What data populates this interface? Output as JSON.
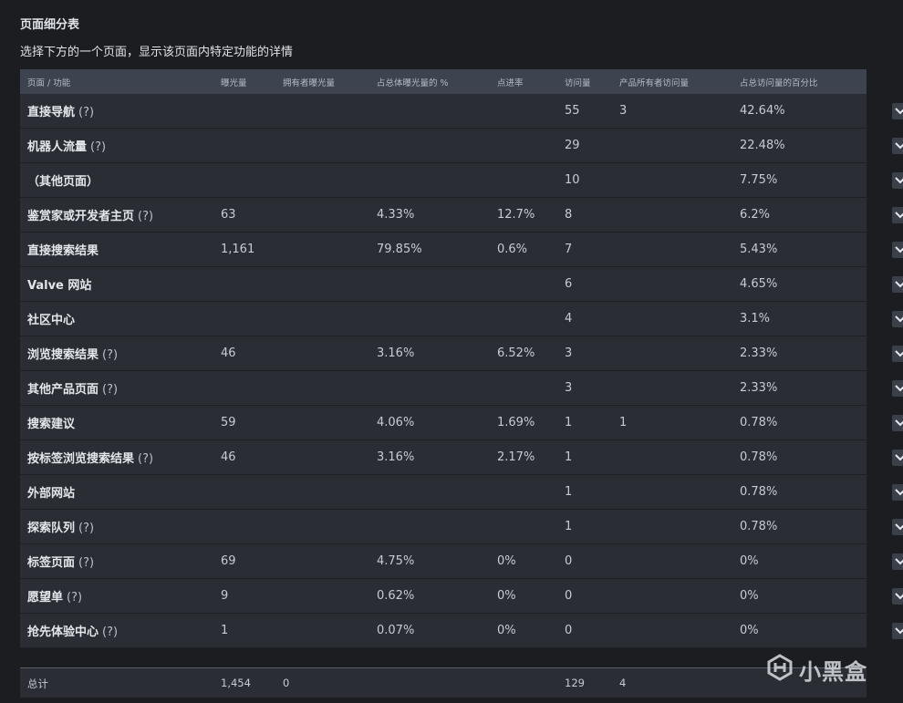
{
  "page": {
    "title": "页面细分表",
    "subtitle": "选择下方的一个页面，显示该页面内特定功能的详情"
  },
  "table": {
    "headers": [
      "页面 / 功能",
      "曝光量",
      "拥有者曝光量",
      "占总体曝光量的 %",
      "点进率",
      "访问量",
      "产品所有者访问量",
      "占总访问量的百分比"
    ],
    "rows": [
      {
        "name": "直接导航",
        "hint": "(?)",
        "impressions": "",
        "owner_impressions": "",
        "impression_pct": "",
        "ctr": "",
        "visits": "55",
        "owner_visits": "3",
        "visit_pct": "42.64%"
      },
      {
        "name": "机器人流量",
        "hint": "(?)",
        "impressions": "",
        "owner_impressions": "",
        "impression_pct": "",
        "ctr": "",
        "visits": "29",
        "owner_visits": "",
        "visit_pct": "22.48%"
      },
      {
        "name": "（其他页面）",
        "hint": "",
        "impressions": "",
        "owner_impressions": "",
        "impression_pct": "",
        "ctr": "",
        "visits": "10",
        "owner_visits": "",
        "visit_pct": "7.75%"
      },
      {
        "name": "鉴赏家或开发者主页",
        "hint": "(?)",
        "impressions": "63",
        "owner_impressions": "",
        "impression_pct": "4.33%",
        "ctr": "12.7%",
        "visits": "8",
        "owner_visits": "",
        "visit_pct": "6.2%"
      },
      {
        "name": "直接搜索结果",
        "hint": "",
        "impressions": "1,161",
        "owner_impressions": "",
        "impression_pct": "79.85%",
        "ctr": "0.6%",
        "visits": "7",
        "owner_visits": "",
        "visit_pct": "5.43%"
      },
      {
        "name": "Valve 网站",
        "hint": "",
        "impressions": "",
        "owner_impressions": "",
        "impression_pct": "",
        "ctr": "",
        "visits": "6",
        "owner_visits": "",
        "visit_pct": "4.65%"
      },
      {
        "name": "社区中心",
        "hint": "",
        "impressions": "",
        "owner_impressions": "",
        "impression_pct": "",
        "ctr": "",
        "visits": "4",
        "owner_visits": "",
        "visit_pct": "3.1%"
      },
      {
        "name": "浏览搜索结果",
        "hint": "(?)",
        "impressions": "46",
        "owner_impressions": "",
        "impression_pct": "3.16%",
        "ctr": "6.52%",
        "visits": "3",
        "owner_visits": "",
        "visit_pct": "2.33%"
      },
      {
        "name": "其他产品页面",
        "hint": "(?)",
        "impressions": "",
        "owner_impressions": "",
        "impression_pct": "",
        "ctr": "",
        "visits": "3",
        "owner_visits": "",
        "visit_pct": "2.33%"
      },
      {
        "name": "搜索建议",
        "hint": "",
        "impressions": "59",
        "owner_impressions": "",
        "impression_pct": "4.06%",
        "ctr": "1.69%",
        "visits": "1",
        "owner_visits": "1",
        "visit_pct": "0.78%"
      },
      {
        "name": "按标签浏览搜索结果",
        "hint": "(?)",
        "impressions": "46",
        "owner_impressions": "",
        "impression_pct": "3.16%",
        "ctr": "2.17%",
        "visits": "1",
        "owner_visits": "",
        "visit_pct": "0.78%"
      },
      {
        "name": "外部网站",
        "hint": "",
        "impressions": "",
        "owner_impressions": "",
        "impression_pct": "",
        "ctr": "",
        "visits": "1",
        "owner_visits": "",
        "visit_pct": "0.78%"
      },
      {
        "name": "探索队列",
        "hint": "(?)",
        "impressions": "",
        "owner_impressions": "",
        "impression_pct": "",
        "ctr": "",
        "visits": "1",
        "owner_visits": "",
        "visit_pct": "0.78%"
      },
      {
        "name": "标签页面",
        "hint": "(?)",
        "impressions": "69",
        "owner_impressions": "",
        "impression_pct": "4.75%",
        "ctr": "0%",
        "visits": "0",
        "owner_visits": "",
        "visit_pct": "0%"
      },
      {
        "name": "愿望单",
        "hint": "(?)",
        "impressions": "9",
        "owner_impressions": "",
        "impression_pct": "0.62%",
        "ctr": "0%",
        "visits": "0",
        "owner_visits": "",
        "visit_pct": "0%"
      },
      {
        "name": "抢先体验中心",
        "hint": "(?)",
        "impressions": "1",
        "owner_impressions": "",
        "impression_pct": "0.07%",
        "ctr": "0%",
        "visits": "0",
        "owner_visits": "",
        "visit_pct": "0%"
      }
    ],
    "total": {
      "label": "总计",
      "impressions": "1,454",
      "owner_impressions": "0",
      "visits": "129",
      "owner_visits": "4"
    }
  },
  "watermark": {
    "text": "小黑盒"
  },
  "icons": {
    "expand": "chevron-down-icon",
    "watermark_logo": "xiaoheihe-logo-icon"
  }
}
